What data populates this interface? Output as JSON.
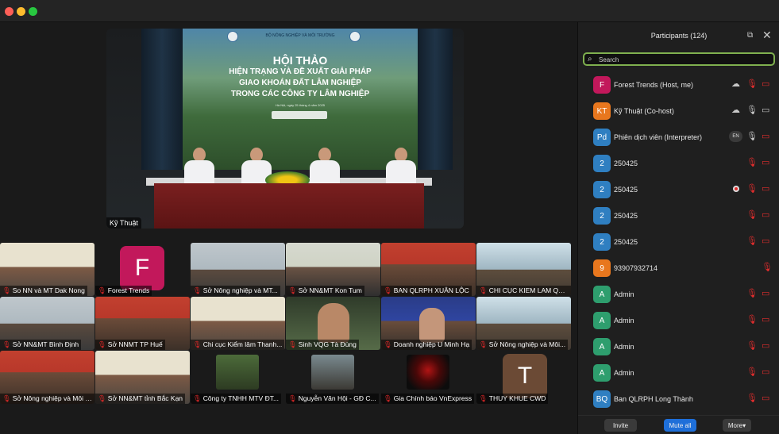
{
  "window": {
    "title": ""
  },
  "speaker": {
    "name": "Kỹ Thuật",
    "banner": {
      "org": "BỘ NÔNG NGHIỆP VÀ MÔI TRƯỜNG",
      "title": "HỘI THẢO",
      "subtitle_lines": [
        "HIỆN TRẠNG VÀ ĐỀ XUẤT GIẢI PHÁP",
        "GIAO KHOÁN ĐẤT LÂM NGHIỆP",
        "TRONG CÁC CÔNG TY LÂM NGHIỆP"
      ],
      "date": "Hà Nội, ngày 25 tháng 4 năm 2025"
    }
  },
  "gallery": [
    {
      "label": "So NN và MT Dak Nong"
    },
    {
      "label": "Forest Trends",
      "initial": "F"
    },
    {
      "label": "Sở Nông nghiệp và MT..."
    },
    {
      "label": "Sở NN&MT Kon Tum"
    },
    {
      "label": "BAN QLRPH XUÂN LỘC"
    },
    {
      "label": "CHI CỤC KIEM LAM QU..."
    },
    {
      "label": "Sở NN&MT Bình Định"
    },
    {
      "label": "Sở NNMT TP Huế"
    },
    {
      "label": "Chi cục Kiểm lâm Thanh..."
    },
    {
      "label": "Sinh VQG Tà Đùng"
    },
    {
      "label": "Doanh nghiệp U Minh Hạ"
    },
    {
      "label": "Sở Nông nghiệp và Môi..."
    },
    {
      "label": "Sở Nông nghiệp và Môi t..."
    },
    {
      "label": "Sở NN&MT tỉnh Bắc Kạn"
    },
    {
      "label": "Công ty TNHH MTV ĐT..."
    },
    {
      "label": "Nguyễn Văn Hội - GĐ C..."
    },
    {
      "label": "Gia Chính báo VnExpress"
    },
    {
      "label": "THUY KHUE CWD",
      "initial": "T"
    }
  ],
  "panel": {
    "title": "Participants (124)",
    "search_placeholder": "Search",
    "participants": [
      {
        "initials": "F",
        "name": "Forest Trends (Host, me)",
        "color": "#c2185b"
      },
      {
        "initials": "KT",
        "name": "Kỹ Thuật (Co-host)",
        "color": "#e8771e"
      },
      {
        "initials": "Pd",
        "name": "Phiên dịch viên (Interpreter)",
        "color": "#2f7fc1",
        "badge": "EN"
      },
      {
        "initials": "2",
        "name": "250425",
        "color": "#2f7fc1"
      },
      {
        "initials": "2",
        "name": "250425",
        "color": "#2f7fc1"
      },
      {
        "initials": "2",
        "name": "250425",
        "color": "#2f7fc1"
      },
      {
        "initials": "2",
        "name": "250425",
        "color": "#2f7fc1"
      },
      {
        "initials": "9",
        "name": "93907932714",
        "color": "#e8771e"
      },
      {
        "initials": "A",
        "name": "Admin",
        "color": "#2e9e6e"
      },
      {
        "initials": "A",
        "name": "Admin",
        "color": "#2e9e6e"
      },
      {
        "initials": "A",
        "name": "Admin",
        "color": "#2e9e6e"
      },
      {
        "initials": "A",
        "name": "Admin",
        "color": "#2e9e6e"
      },
      {
        "initials": "BQ",
        "name": "Ban QLRPH Long Thành",
        "color": "#2f7fc1"
      }
    ],
    "buttons": {
      "invite": "Invite",
      "mute_all": "Mute all",
      "more": "More▾"
    }
  },
  "colors": {
    "accent": "#1e6fd9",
    "muted": "#e22d2d",
    "search_border": "#7fb04f"
  }
}
